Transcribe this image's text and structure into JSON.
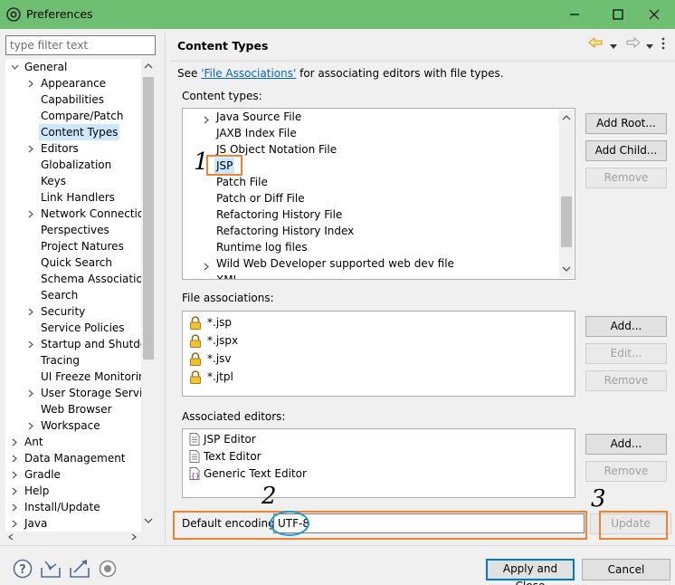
{
  "window": {
    "title": "Preferences"
  },
  "filter": {
    "placeholder": "type filter text"
  },
  "tree": [
    {
      "label": "General",
      "indent": 0,
      "twist": "open"
    },
    {
      "label": "Appearance",
      "indent": 1,
      "twist": "closed"
    },
    {
      "label": "Capabilities",
      "indent": 1,
      "twist": ""
    },
    {
      "label": "Compare/Patch",
      "indent": 1,
      "twist": ""
    },
    {
      "label": "Content Types",
      "indent": 1,
      "twist": "",
      "selected": true
    },
    {
      "label": "Editors",
      "indent": 1,
      "twist": "closed"
    },
    {
      "label": "Globalization",
      "indent": 1,
      "twist": ""
    },
    {
      "label": "Keys",
      "indent": 1,
      "twist": ""
    },
    {
      "label": "Link Handlers",
      "indent": 1,
      "twist": ""
    },
    {
      "label": "Network Connections",
      "indent": 1,
      "twist": "closed"
    },
    {
      "label": "Perspectives",
      "indent": 1,
      "twist": ""
    },
    {
      "label": "Project Natures",
      "indent": 1,
      "twist": ""
    },
    {
      "label": "Quick Search",
      "indent": 1,
      "twist": ""
    },
    {
      "label": "Schema Associations",
      "indent": 1,
      "twist": ""
    },
    {
      "label": "Search",
      "indent": 1,
      "twist": ""
    },
    {
      "label": "Security",
      "indent": 1,
      "twist": "closed"
    },
    {
      "label": "Service Policies",
      "indent": 1,
      "twist": ""
    },
    {
      "label": "Startup and Shutdown",
      "indent": 1,
      "twist": "closed"
    },
    {
      "label": "Tracing",
      "indent": 1,
      "twist": ""
    },
    {
      "label": "UI Freeze Monitoring",
      "indent": 1,
      "twist": ""
    },
    {
      "label": "User Storage Service",
      "indent": 1,
      "twist": "closed"
    },
    {
      "label": "Web Browser",
      "indent": 1,
      "twist": ""
    },
    {
      "label": "Workspace",
      "indent": 1,
      "twist": "closed"
    },
    {
      "label": "Ant",
      "indent": 0,
      "twist": "closed"
    },
    {
      "label": "Data Management",
      "indent": 0,
      "twist": "closed"
    },
    {
      "label": "Gradle",
      "indent": 0,
      "twist": "closed"
    },
    {
      "label": "Help",
      "indent": 0,
      "twist": "closed"
    },
    {
      "label": "Install/Update",
      "indent": 0,
      "twist": "closed"
    },
    {
      "label": "Java",
      "indent": 0,
      "twist": "closed"
    }
  ],
  "page": {
    "title": "Content Types",
    "intro_prefix": "See ",
    "intro_link": "'File Associations'",
    "intro_suffix": " for associating editors with file types."
  },
  "content_types": {
    "label": "Content types:",
    "items": [
      {
        "label": "Java Source File",
        "twist": "closed"
      },
      {
        "label": "JAXB Index File",
        "twist": ""
      },
      {
        "label": "JS Object Notation File",
        "twist": ""
      },
      {
        "label": "JSP",
        "twist": "",
        "selected": true
      },
      {
        "label": "Patch File",
        "twist": ""
      },
      {
        "label": "Patch or Diff File",
        "twist": ""
      },
      {
        "label": "Refactoring History File",
        "twist": ""
      },
      {
        "label": "Refactoring History Index",
        "twist": ""
      },
      {
        "label": "Runtime log files",
        "twist": ""
      },
      {
        "label": "Wild Web Developer supported web dev file",
        "twist": "closed"
      },
      {
        "label": "XML",
        "twist": "closed"
      }
    ],
    "buttons": {
      "add_root": "Add Root...",
      "add_child": "Add Child...",
      "remove": "Remove"
    }
  },
  "file_associations": {
    "label": "File associations:",
    "items": [
      "*.jsp",
      "*.jspx",
      "*.jsv",
      "*.jtpl"
    ],
    "buttons": {
      "add": "Add...",
      "edit": "Edit...",
      "remove": "Remove"
    }
  },
  "associated_editors": {
    "label": "Associated editors:",
    "items": [
      "JSP Editor",
      "Text Editor",
      "Generic Text Editor"
    ],
    "buttons": {
      "add": "Add...",
      "remove": "Remove"
    }
  },
  "encoding": {
    "label": "Default encoding:",
    "value": "UTF-8",
    "update": "Update"
  },
  "footer": {
    "apply_close": "Apply and Close",
    "cancel": "Cancel"
  },
  "annotations": {
    "one": "1",
    "two": "2",
    "three": "3"
  },
  "colors": {
    "titlebar": "#6fbf73",
    "annotation_box": "#f0822d",
    "annotation_circle": "#1f9ad6",
    "link": "#0066cc",
    "selection": "#cce8ff"
  }
}
